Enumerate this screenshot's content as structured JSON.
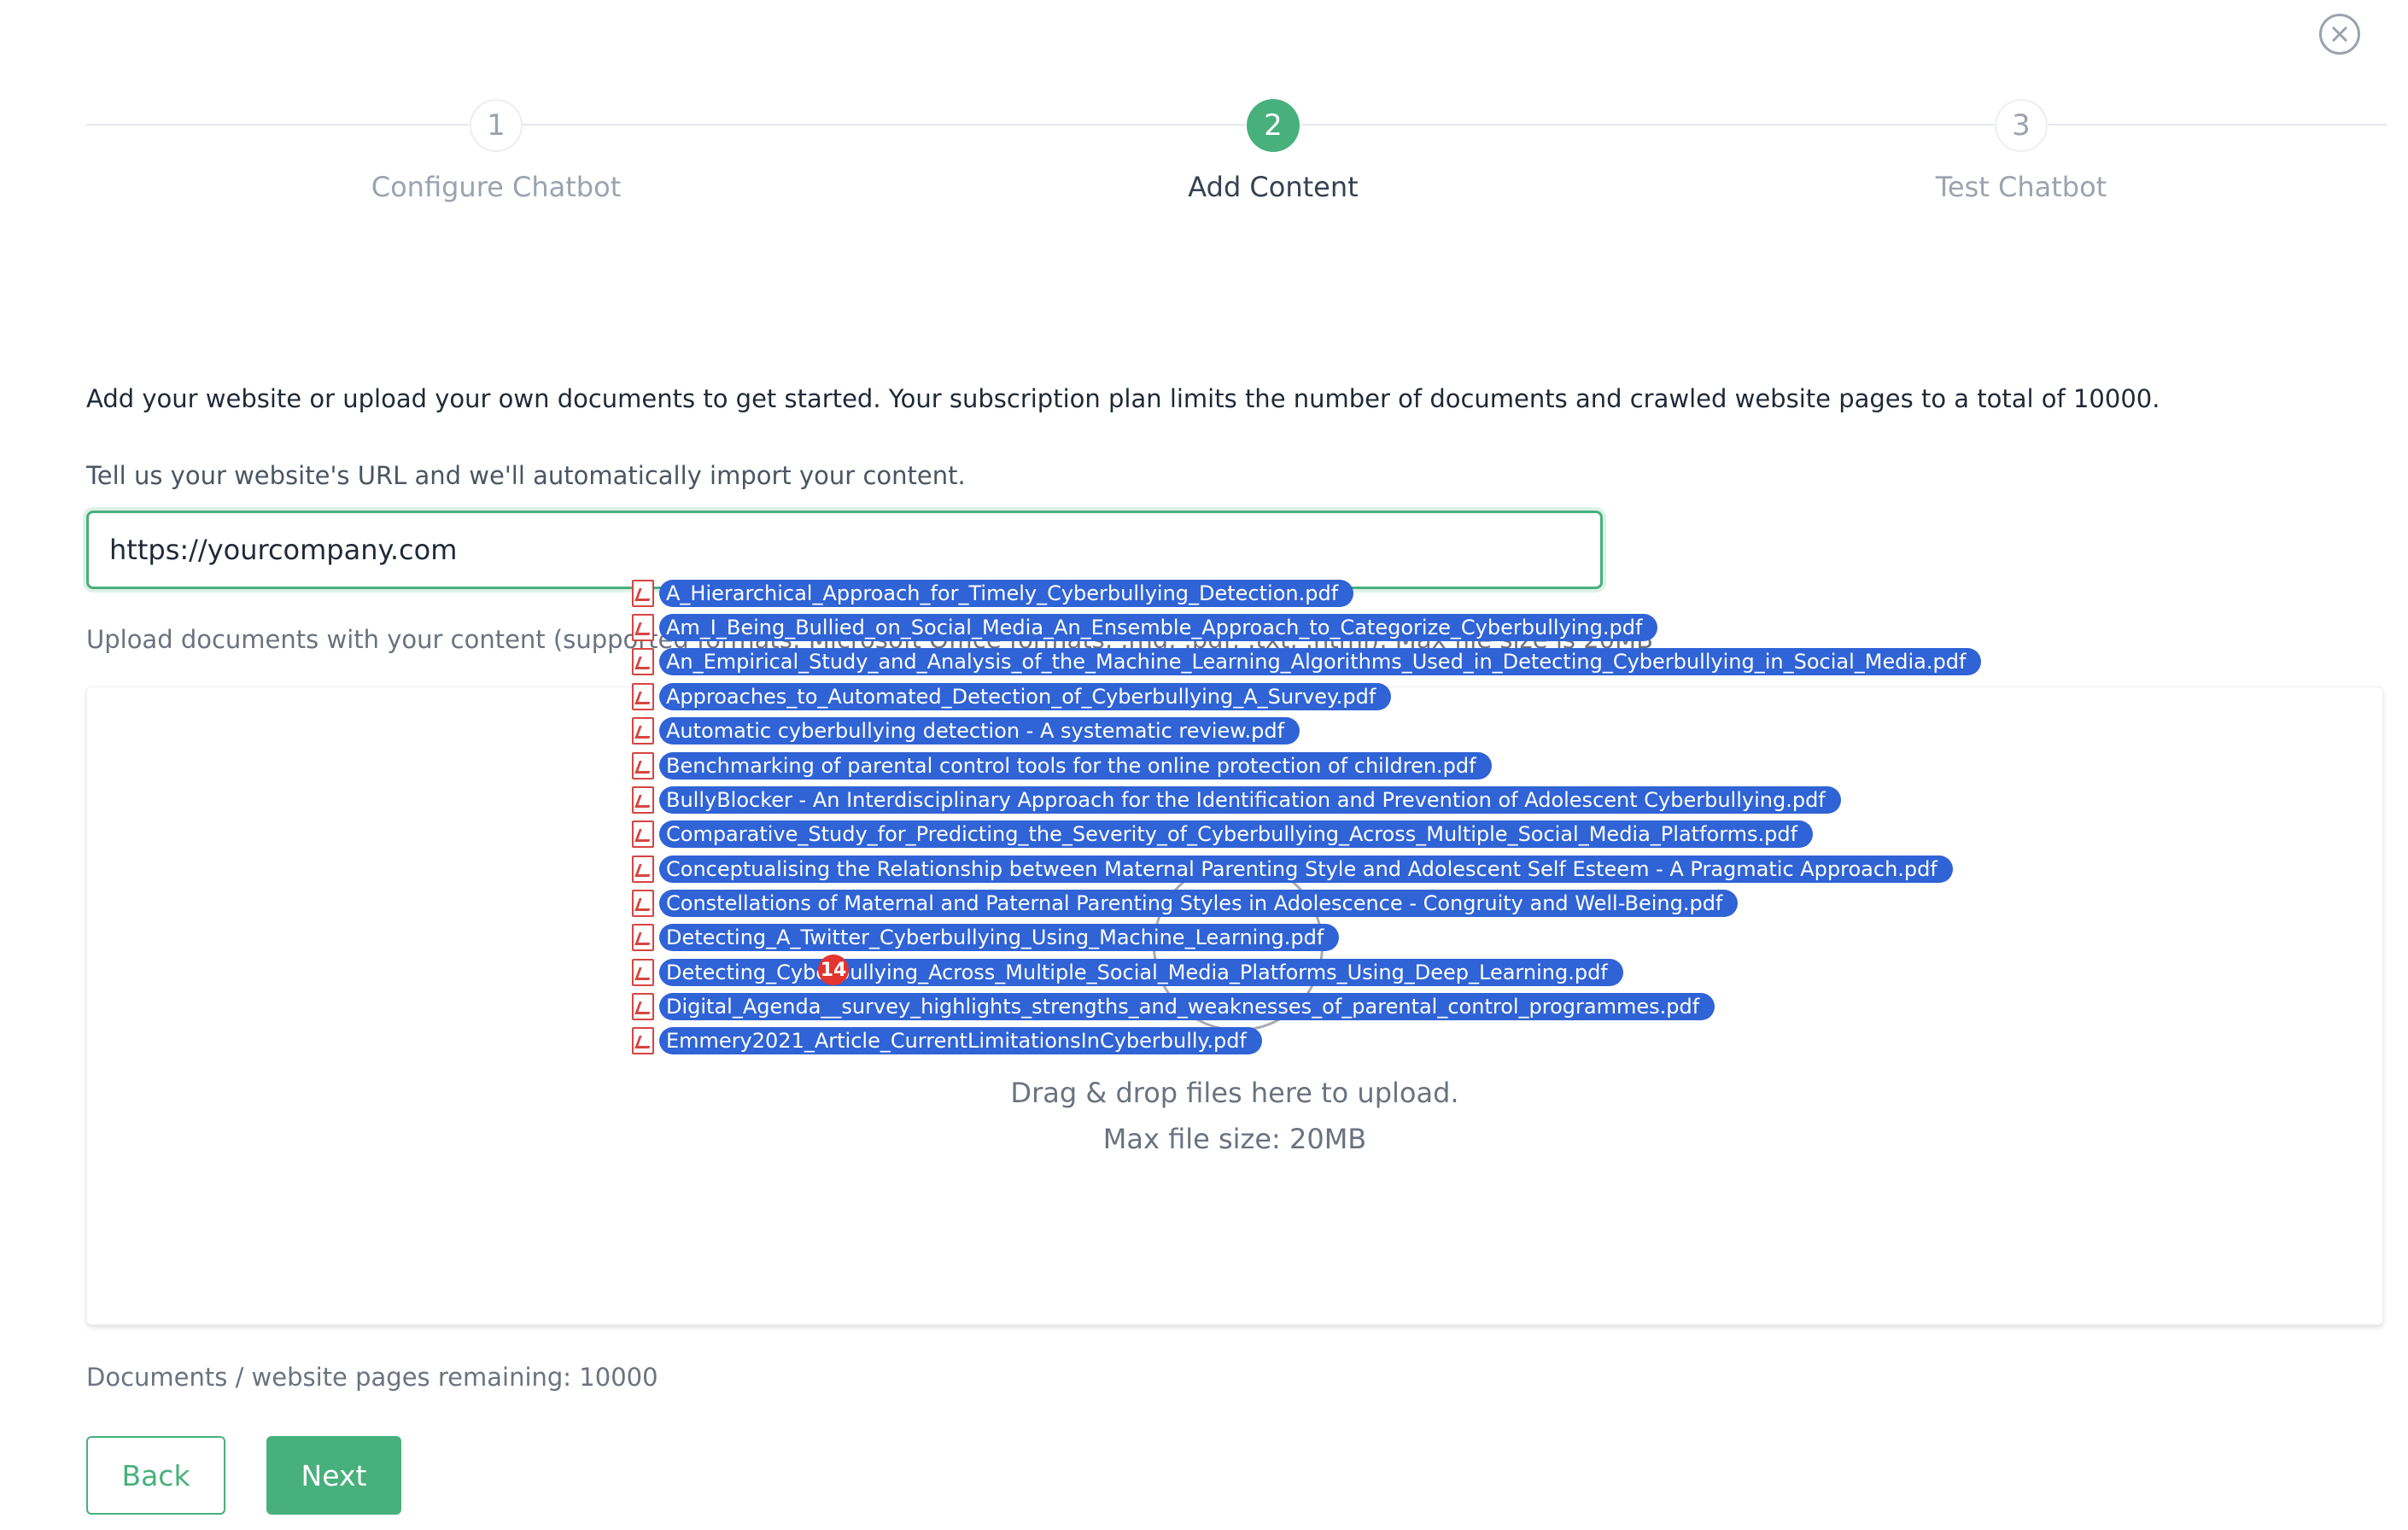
{
  "stepper": {
    "steps": [
      {
        "number": "1",
        "label": "Configure Chatbot",
        "state": "inactive"
      },
      {
        "number": "2",
        "label": "Add Content",
        "state": "active"
      },
      {
        "number": "3",
        "label": "Test Chatbot",
        "state": "inactive"
      }
    ]
  },
  "content": {
    "intro": "Add your website or upload your own documents to get started. Your subscription plan limits the number of documents and crawled website pages to a total of 10000.",
    "url_label": "Tell us your website's URL and we'll automatically import your content.",
    "url_value": "https://yourcompany.com",
    "upload_label": "Upload documents with your content (supported formats: Microsoft Office formats, .md, .pdf, .txt, .html). Max file size is 20MB",
    "dropzone": {
      "line1": "Drag & drop files here to upload.",
      "line2": "Max file size: 20MB"
    },
    "remaining": "Documents / website pages remaining: 10000"
  },
  "buttons": {
    "back": "Back",
    "next": "Next"
  },
  "drag": {
    "count": "14",
    "files": [
      "A_Hierarchical_Approach_for_Timely_Cyberbullying_Detection.pdf",
      "Am_I_Being_Bullied_on_Social_Media_An_Ensemble_Approach_to_Categorize_Cyberbullying.pdf",
      "An_Empirical_Study_and_Analysis_of_the_Machine_Learning_Algorithms_Used_in_Detecting_Cyberbullying_in_Social_Media.pdf",
      "Approaches_to_Automated_Detection_of_Cyberbullying_A_Survey.pdf",
      "Automatic cyberbullying detection - A systematic review.pdf",
      "Benchmarking of parental control tools for the online protection of children.pdf",
      "BullyBlocker - An Interdisciplinary Approach for the Identification and Prevention of Adolescent Cyberbullying.pdf",
      "Comparative_Study_for_Predicting_the_Severity_of_Cyberbullying_Across_Multiple_Social_Media_Platforms.pdf",
      "Conceptualising the Relationship between Maternal Parenting Style and Adolescent Self Esteem - A Pragmatic Approach.pdf",
      "Constellations of Maternal and Paternal Parenting Styles in Adolescence - Congruity and Well-Being.pdf",
      "Detecting_A_Twitter_Cyberbullying_Using_Machine_Learning.pdf",
      "Detecting_Cyberbullying_Across_Multiple_Social_Media_Platforms_Using_Deep_Learning.pdf",
      "Digital_Agenda__survey_highlights_strengths_and_weaknesses_of_parental_control_programmes.pdf",
      "Emmery2021_Article_CurrentLimitationsInCyberbully.pdf"
    ]
  },
  "colors": {
    "accent": "#48b07c",
    "chip": "#2f63d6",
    "badge": "#e3342f"
  },
  "icons": {
    "close": "close-circle-icon",
    "file": "pdf-file-icon"
  }
}
